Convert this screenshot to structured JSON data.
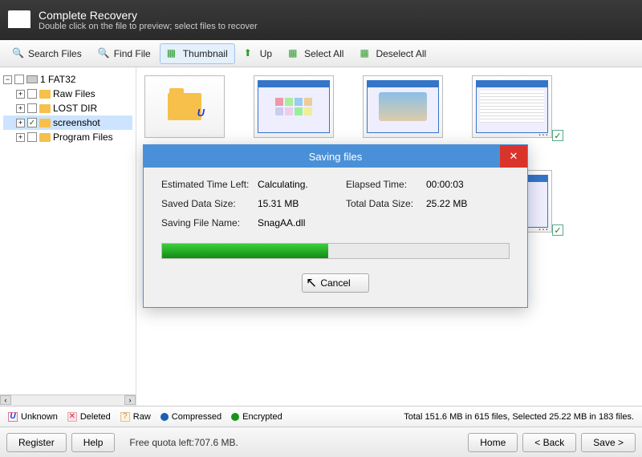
{
  "header": {
    "title": "Complete Recovery",
    "subtitle": "Double click on the file to preview; select files to recover"
  },
  "toolbar": {
    "searchFiles": "Search Files",
    "findFile": "Find File",
    "thumbnail": "Thumbnail",
    "up": "Up",
    "selectAll": "Select All",
    "deselectAll": "Deselect All"
  },
  "tree": {
    "root": "1 FAT32",
    "children": [
      {
        "label": "Raw Files",
        "checked": false
      },
      {
        "label": "LOST DIR",
        "checked": false
      },
      {
        "label": "screenshot",
        "checked": true,
        "selected": true
      },
      {
        "label": "Program Files",
        "checked": false
      }
    ]
  },
  "legend": {
    "unknown": "Unknown",
    "deleted": "Deleted",
    "raw": "Raw",
    "compressed": "Compressed",
    "encrypted": "Encrypted",
    "stats": "Total 151.6 MB in 615 files, Selected 25.22 MB in 183 files."
  },
  "bottom": {
    "register": "Register",
    "help": "Help",
    "quota": "Free quota left:707.6 MB.",
    "home": "Home",
    "back": "< Back",
    "save": "Save >"
  },
  "dialog": {
    "title": "Saving files",
    "labels": {
      "etl": "Estimated Time Left:",
      "etlv": "Calculating.",
      "elapsed": "Elapsed Time:",
      "elapsedv": "00:00:03",
      "saved": "Saved Data Size:",
      "savedv": "15.31 MB",
      "total": "Total Data Size:",
      "totalv": "25.22 MB",
      "file": "Saving File Name:",
      "filev": "SnagAA.dll"
    },
    "cancel": "Cancel"
  }
}
